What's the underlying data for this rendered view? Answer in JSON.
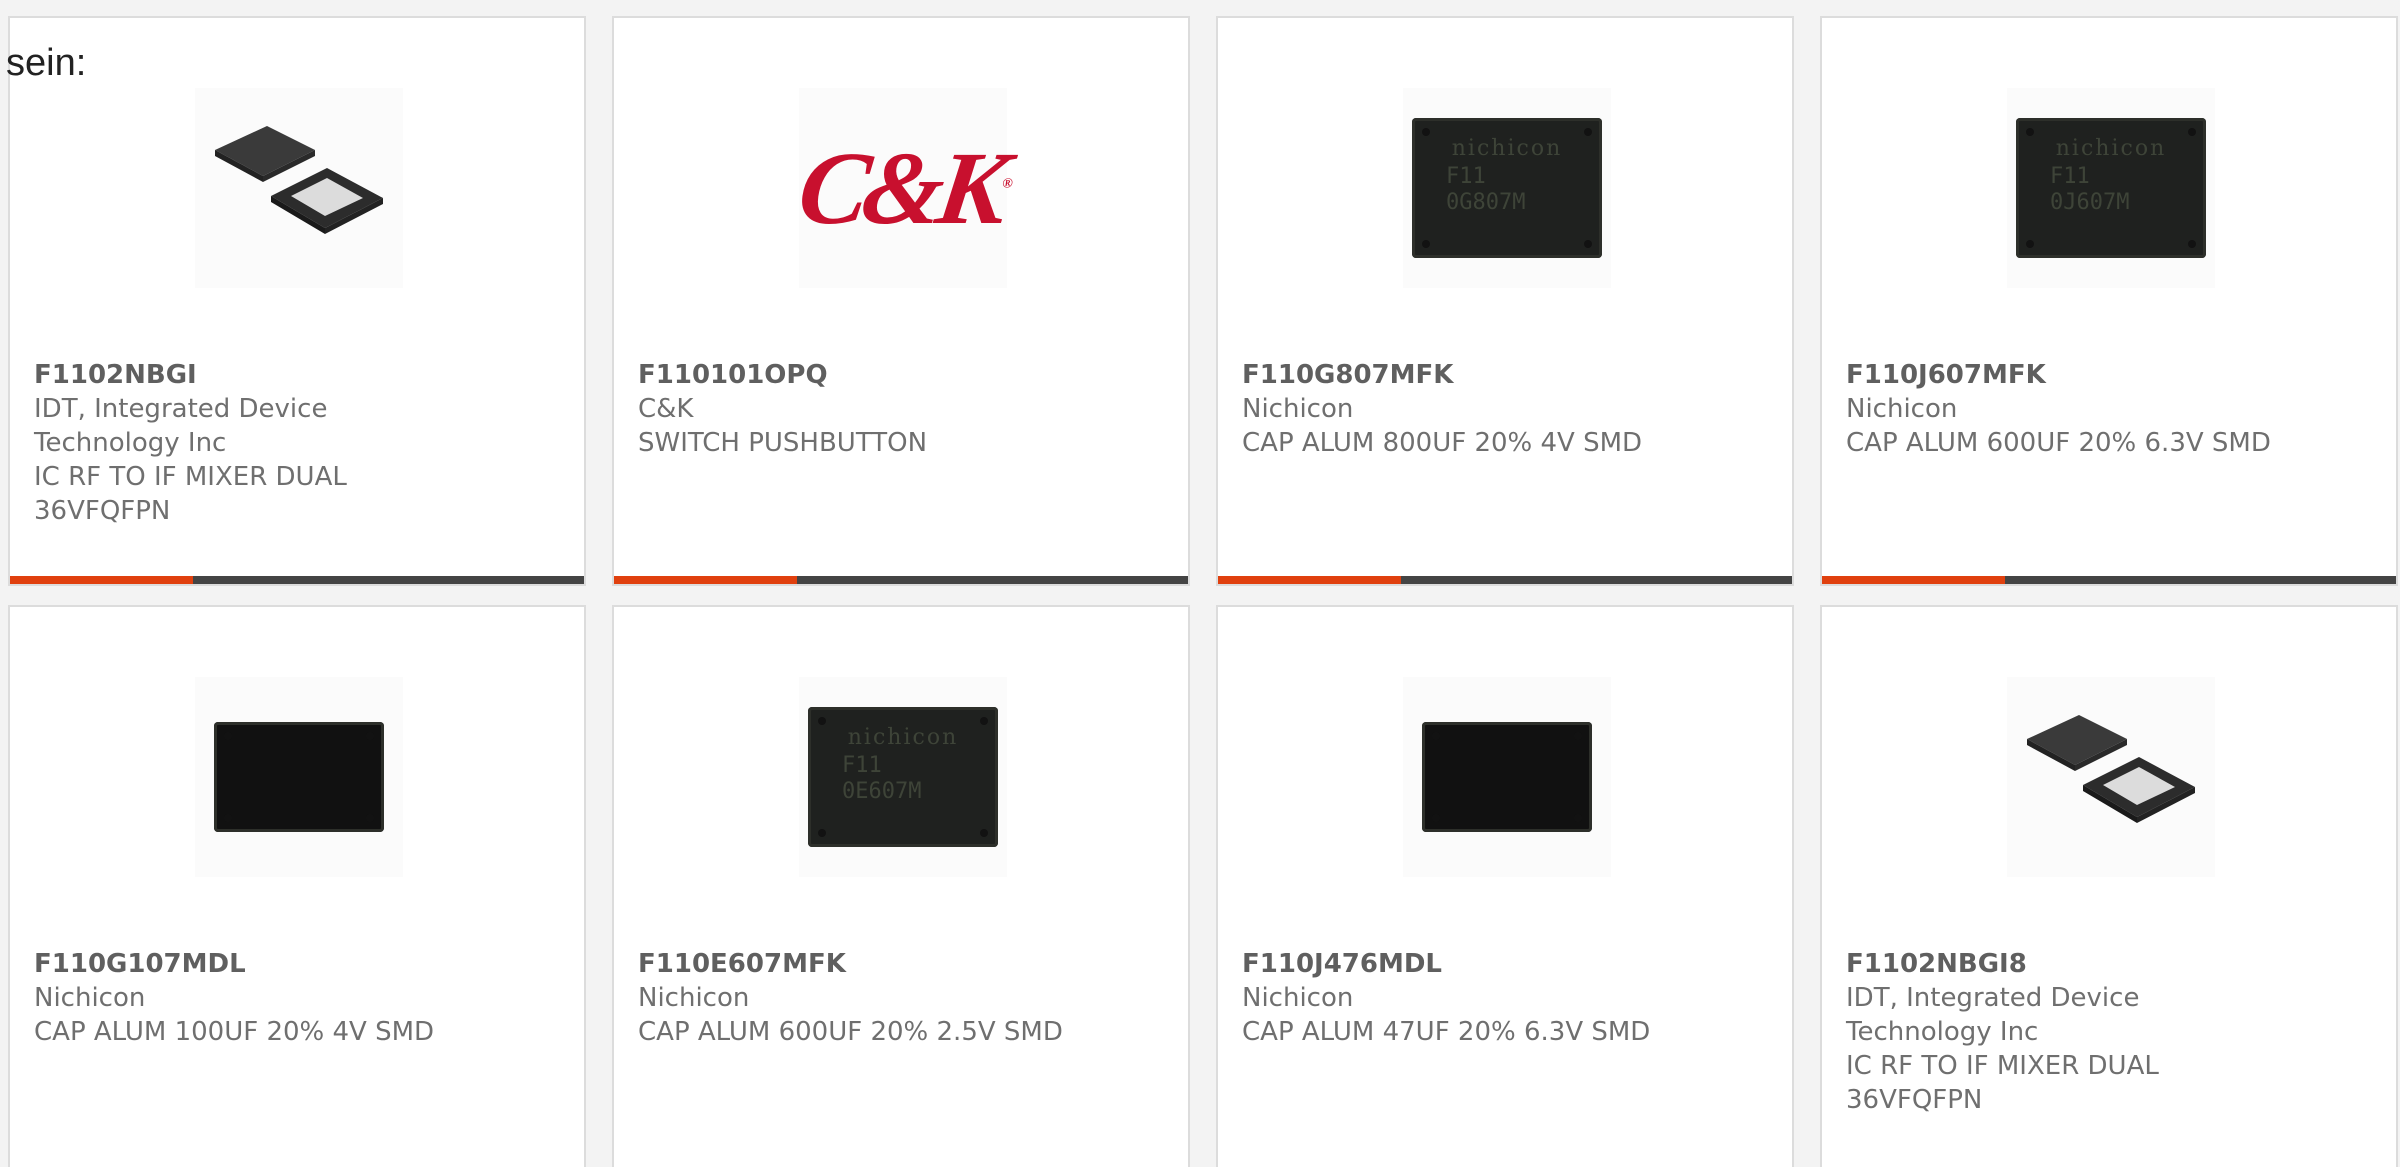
{
  "intro_text": "sein:",
  "products": [
    {
      "part_number": "F1102NBGI",
      "manufacturer": "IDT, Integrated Device Technology Inc",
      "description": "IC RF TO IF MIXER DUAL 36VFQFPN",
      "image_icon": "qfn-chip-icon"
    },
    {
      "part_number": "F110101OPQ",
      "manufacturer": "C&K",
      "description": "SWITCH PUSHBUTTON",
      "image_icon": "ck-logo",
      "logo_text": "C&K"
    },
    {
      "part_number": "F110G807MFK",
      "manufacturer": "Nichicon",
      "description": "CAP ALUM 800UF 20% 4V SMD",
      "image_icon": "capacitor-icon",
      "marking": {
        "brand": "nichicon",
        "lines": "F11\n0G807M"
      }
    },
    {
      "part_number": "F110J607MFK",
      "manufacturer": "Nichicon",
      "description": "CAP ALUM 600UF 20% 6.3V SMD",
      "image_icon": "capacitor-icon",
      "marking": {
        "brand": "nichicon",
        "lines": "F11\n0J607M"
      }
    },
    {
      "part_number": "F110G107MDL",
      "manufacturer": "Nichicon",
      "description": "CAP ALUM 100UF 20% 4V SMD",
      "image_icon": "capacitor-icon"
    },
    {
      "part_number": "F110E607MFK",
      "manufacturer": "Nichicon",
      "description": "CAP ALUM 600UF 20% 2.5V SMD",
      "image_icon": "capacitor-icon",
      "marking": {
        "brand": "nichicon",
        "lines": "F11\n0E607M"
      }
    },
    {
      "part_number": "F110J476MDL",
      "manufacturer": "Nichicon",
      "description": "CAP ALUM 47UF 20% 6.3V SMD",
      "image_icon": "capacitor-icon"
    },
    {
      "part_number": "F1102NBGI8",
      "manufacturer": "IDT, Integrated Device Technology Inc",
      "description": "IC RF TO IF MIXER DUAL 36VFQFPN",
      "image_icon": "qfn-chip-icon"
    }
  ],
  "colors": {
    "accent": "#e0400e",
    "bar": "#444444",
    "ck_red": "#c8102e"
  }
}
